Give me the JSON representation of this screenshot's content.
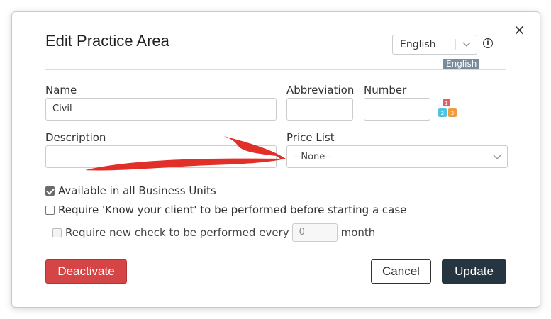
{
  "dialog": {
    "title": "Edit Practice Area",
    "close_symbol": "×",
    "language": {
      "selected": "English",
      "badge": "English"
    }
  },
  "form": {
    "name": {
      "label": "Name",
      "value": "Civil"
    },
    "abbreviation": {
      "label": "Abbreviation",
      "value": ""
    },
    "number": {
      "label": "Number",
      "value": ""
    },
    "description": {
      "label": "Description",
      "value": ""
    },
    "price_list": {
      "label": "Price List",
      "selected": "--None--"
    }
  },
  "options": {
    "available_all_units": {
      "label": "Available in all Business Units",
      "checked": true
    },
    "require_kyc": {
      "label": "Require 'Know your client' to be performed before starting a case",
      "checked": false
    },
    "require_new_check": {
      "label_before": "Require new check to be performed every",
      "months_value": "0",
      "label_after": "month",
      "checked": false,
      "disabled": true
    }
  },
  "buttons": {
    "deactivate": "Deactivate",
    "cancel": "Cancel",
    "update": "Update"
  },
  "colors": {
    "deactivate": "#d64545",
    "update": "#253640",
    "annotation_arrow": "#e0241b",
    "badge": "#7a8c99"
  },
  "icons": [
    "close-icon",
    "chevron-down-icon",
    "info-icon",
    "abc-blocks-icon",
    "checkbox-icon"
  ]
}
